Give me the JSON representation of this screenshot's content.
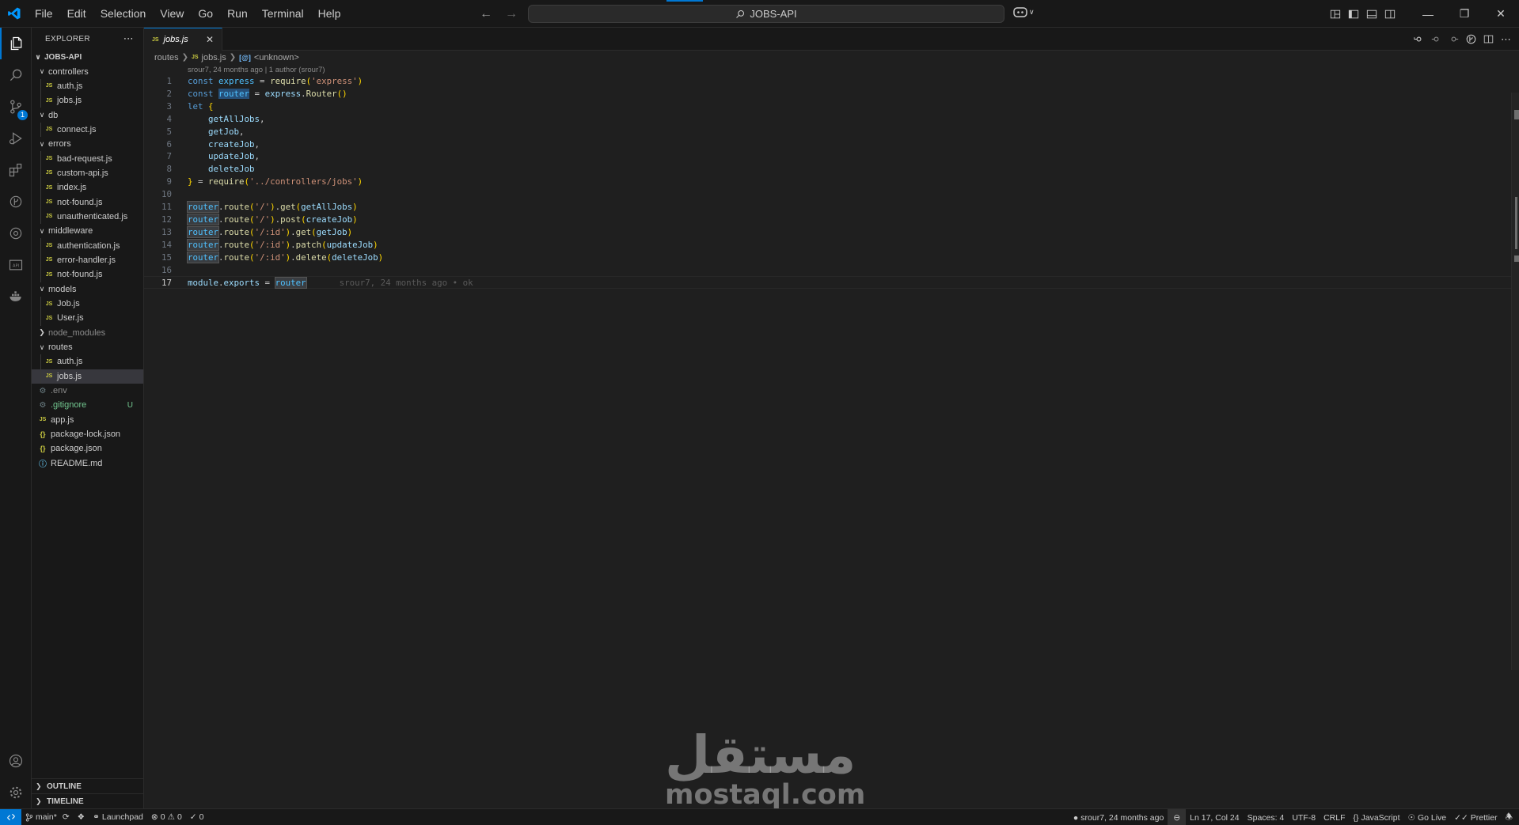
{
  "titlebar": {
    "menu": [
      "File",
      "Edit",
      "Selection",
      "View",
      "Go",
      "Run",
      "Terminal",
      "Help"
    ],
    "search_text": "JOBS-API"
  },
  "sidebar": {
    "title": "EXPLORER",
    "root": "JOBS-API",
    "tree": [
      {
        "label": "controllers",
        "type": "folder",
        "depth": 1,
        "open": true
      },
      {
        "label": "auth.js",
        "type": "js",
        "depth": 2
      },
      {
        "label": "jobs.js",
        "type": "js",
        "depth": 2
      },
      {
        "label": "db",
        "type": "folder",
        "depth": 1,
        "open": true
      },
      {
        "label": "connect.js",
        "type": "js",
        "depth": 2
      },
      {
        "label": "errors",
        "type": "folder",
        "depth": 1,
        "open": true
      },
      {
        "label": "bad-request.js",
        "type": "js",
        "depth": 2
      },
      {
        "label": "custom-api.js",
        "type": "js",
        "depth": 2
      },
      {
        "label": "index.js",
        "type": "js",
        "depth": 2
      },
      {
        "label": "not-found.js",
        "type": "js",
        "depth": 2
      },
      {
        "label": "unauthenticated.js",
        "type": "js",
        "depth": 2
      },
      {
        "label": "middleware",
        "type": "folder",
        "depth": 1,
        "open": true
      },
      {
        "label": "authentication.js",
        "type": "js",
        "depth": 2
      },
      {
        "label": "error-handler.js",
        "type": "js",
        "depth": 2
      },
      {
        "label": "not-found.js",
        "type": "js",
        "depth": 2
      },
      {
        "label": "models",
        "type": "folder",
        "depth": 1,
        "open": true
      },
      {
        "label": "Job.js",
        "type": "js",
        "depth": 2
      },
      {
        "label": "User.js",
        "type": "js",
        "depth": 2
      },
      {
        "label": "node_modules",
        "type": "folder",
        "depth": 1,
        "open": false,
        "ignored": true
      },
      {
        "label": "routes",
        "type": "folder",
        "depth": 1,
        "open": true
      },
      {
        "label": "auth.js",
        "type": "js",
        "depth": 2
      },
      {
        "label": "jobs.js",
        "type": "js",
        "depth": 2,
        "selected": true
      },
      {
        "label": ".env",
        "type": "gear",
        "depth": 1,
        "ignored": true
      },
      {
        "label": ".gitignore",
        "type": "gear",
        "depth": 1,
        "untracked": true,
        "status": "U"
      },
      {
        "label": "app.js",
        "type": "js",
        "depth": 1
      },
      {
        "label": "package-lock.json",
        "type": "json",
        "depth": 1
      },
      {
        "label": "package.json",
        "type": "json",
        "depth": 1
      },
      {
        "label": "README.md",
        "type": "info",
        "depth": 1
      }
    ],
    "outline_label": "OUTLINE",
    "timeline_label": "TIMELINE"
  },
  "editor": {
    "tab_label": "jobs.js",
    "tab_icon": "JS",
    "breadcrumb": {
      "folder": "routes",
      "file": "jobs.js",
      "symbol": "<unknown>"
    },
    "blame_header": "srour7, 24 months ago | 1 author (srour7)",
    "inline_blame": "srour7, 24 months ago • ok",
    "active_line": 17,
    "line_count": 17
  },
  "statusbar": {
    "branch": "main*",
    "launchpad": "Launchpad",
    "errors": "0",
    "warnings": "0",
    "ports": "0",
    "blame": "srour7, 24 months ago",
    "position": "Ln 17, Col 24",
    "spaces": "Spaces: 4",
    "encoding": "UTF-8",
    "eol": "CRLF",
    "language": "JavaScript",
    "golive": "Go Live",
    "prettier": "Prettier"
  },
  "watermark": {
    "arabic": "مستقل",
    "latin": "mostaql.com"
  },
  "colors": {
    "accent": "#0078d4",
    "background": "#1f1f1f",
    "keyword": "#569cd6",
    "string": "#ce9178",
    "function": "#dcdcaa"
  }
}
